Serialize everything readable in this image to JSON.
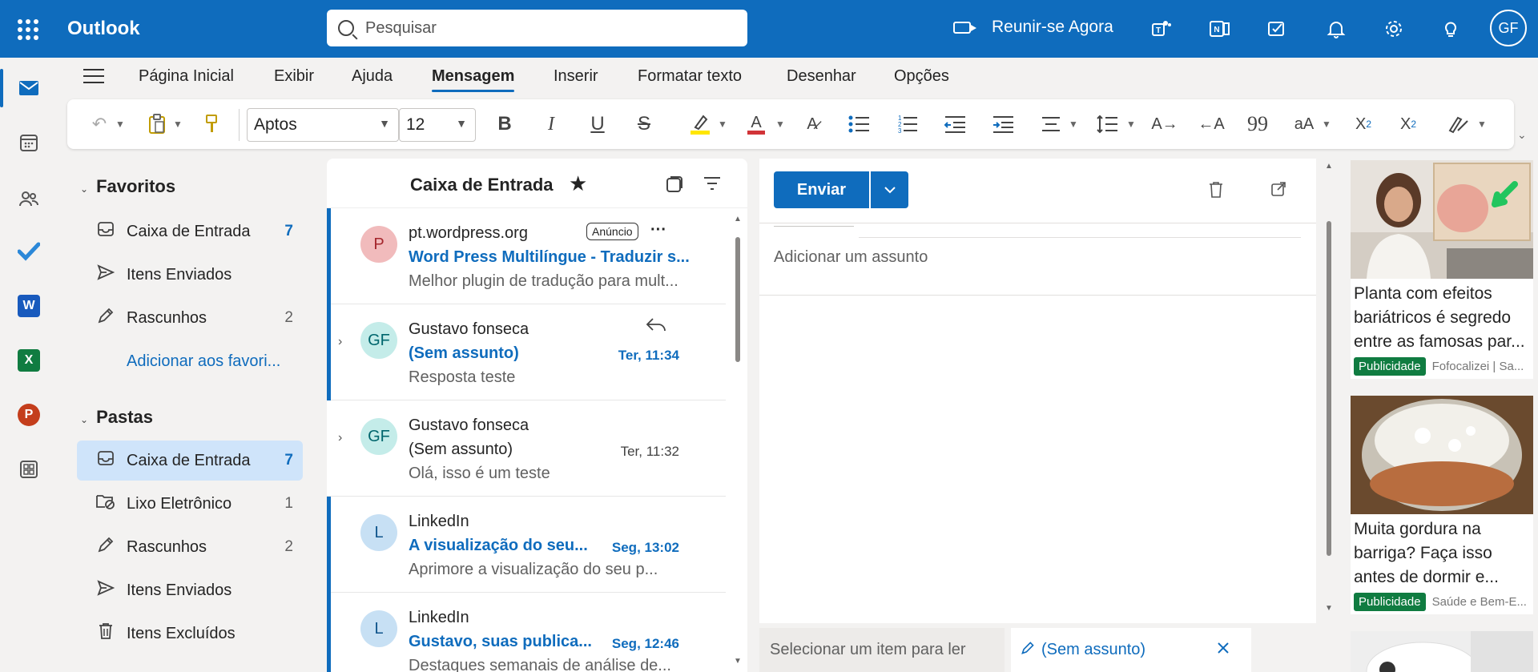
{
  "app": {
    "name": "Outlook"
  },
  "search": {
    "placeholder": "Pesquisar"
  },
  "header": {
    "meet_now": "Reunir-se Agora",
    "avatar_initials": "GF"
  },
  "ribbon": {
    "tabs": [
      "Página Inicial",
      "Exibir",
      "Ajuda",
      "Mensagem",
      "Inserir",
      "Formatar texto",
      "Desenhar",
      "Opções"
    ],
    "active_tab": "Mensagem",
    "font": "Aptos",
    "font_size": "12"
  },
  "folders": {
    "favorites_title": "Favoritos",
    "favorites": [
      {
        "label": "Caixa de Entrada",
        "count": "7"
      },
      {
        "label": "Itens Enviados",
        "count": ""
      },
      {
        "label": "Rascunhos",
        "count": "2"
      },
      {
        "label": "Adicionar aos favori...",
        "count": ""
      }
    ],
    "folders_title": "Pastas",
    "items": [
      {
        "label": "Caixa de Entrada",
        "count": "7"
      },
      {
        "label": "Lixo Eletrônico",
        "count": "1"
      },
      {
        "label": "Rascunhos",
        "count": "2"
      },
      {
        "label": "Itens Enviados",
        "count": ""
      },
      {
        "label": "Itens Excluídos",
        "count": ""
      }
    ]
  },
  "message_list": {
    "title": "Caixa de Entrada",
    "messages": [
      {
        "avatar": "P",
        "sender": "pt.wordpress.org",
        "badge": "Anúncio",
        "subject": "Word Press Multilíngue - Traduzir s...",
        "preview": "Melhor plugin de tradução para mult...",
        "time": ""
      },
      {
        "avatar": "GF",
        "sender": "Gustavo fonseca",
        "subject": "(Sem assunto)",
        "preview": "Resposta teste",
        "time": "Ter, 11:34"
      },
      {
        "avatar": "GF",
        "sender": "Gustavo fonseca",
        "subject": "(Sem assunto)",
        "preview": "Olá, isso é um teste",
        "time": "Ter, 11:32"
      },
      {
        "avatar": "L",
        "sender": "LinkedIn",
        "subject": "A visualização do seu...",
        "preview": "Aprimore a visualização do seu p...",
        "time": "Seg, 13:02"
      },
      {
        "avatar": "L",
        "sender": "LinkedIn",
        "subject": "Gustavo, suas publica...",
        "preview": "Destaques semanais de análise de...",
        "time": "Seg, 12:46"
      }
    ]
  },
  "compose": {
    "send_label": "Enviar",
    "subject_placeholder": "Adicionar um assunto"
  },
  "bottom_tabs": {
    "reading": "Selecionar um item para ler",
    "draft": "(Sem assunto)"
  },
  "ads": [
    {
      "text": "Planta com efeitos bariátricos é segredo entre as famosas par...",
      "label": "Publicidade",
      "source": "Fofocalizei | Sa..."
    },
    {
      "text": "Muita gordura na barriga? Faça isso antes de dormir e...",
      "label": "Publicidade",
      "source": "Saúde e Bem-E..."
    }
  ],
  "colors": {
    "brand": "#0f6cbd",
    "selected": "#cfe4fa",
    "ad_label": "#107c41"
  }
}
